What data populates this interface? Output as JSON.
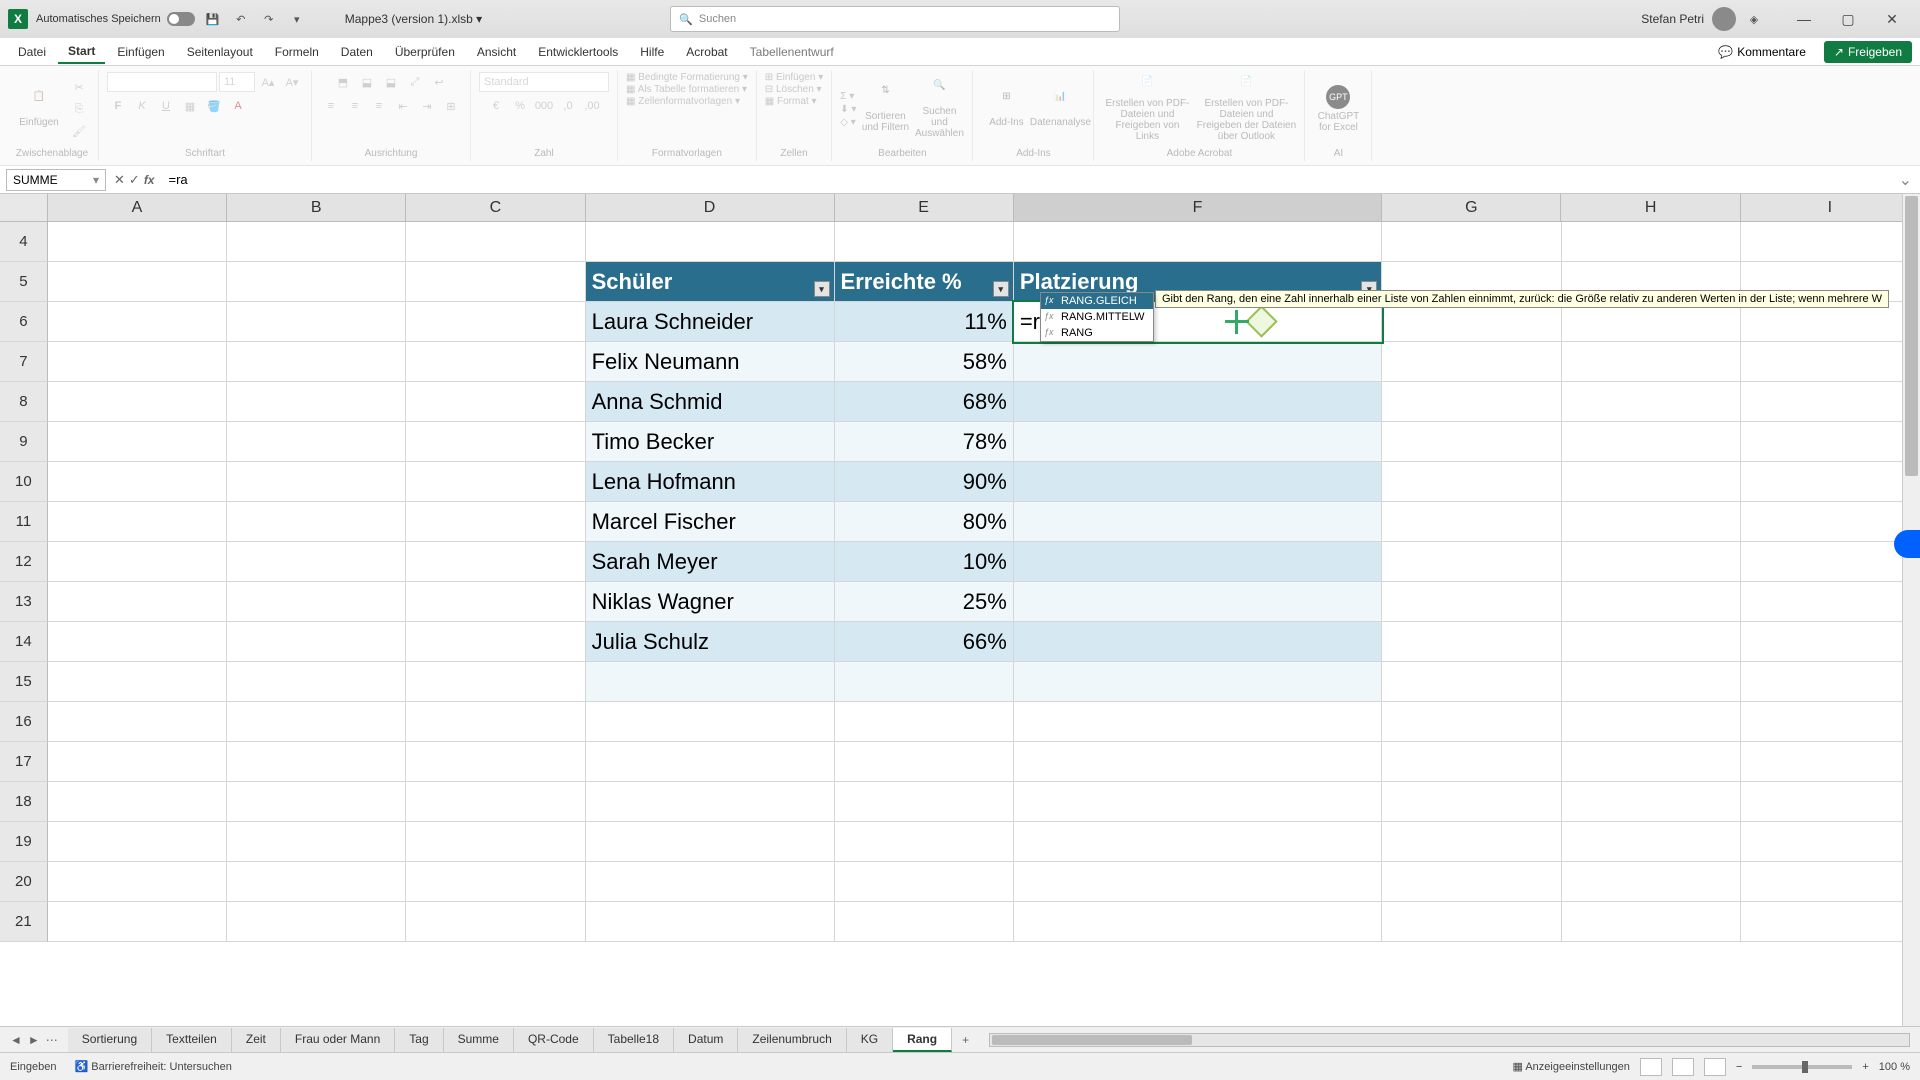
{
  "titlebar": {
    "autosave": "Automatisches Speichern",
    "filename": "Mappe3 (version 1).xlsb",
    "search_placeholder": "Suchen",
    "user": "Stefan Petri"
  },
  "tabs": {
    "datei": "Datei",
    "start": "Start",
    "einfuegen": "Einfügen",
    "seitenlayout": "Seitenlayout",
    "formeln": "Formeln",
    "daten": "Daten",
    "ueberpruefen": "Überprüfen",
    "ansicht": "Ansicht",
    "entwicklertools": "Entwicklertools",
    "hilfe": "Hilfe",
    "acrobat": "Acrobat",
    "tabellenentwurf": "Tabellenentwurf",
    "kommentare": "Kommentare",
    "freigeben": "Freigeben"
  },
  "ribbon": {
    "einfuegen": "Einfügen",
    "zwischenablage": "Zwischenablage",
    "schriftart": "Schriftart",
    "ausrichtung": "Ausrichtung",
    "zahl": "Zahl",
    "formatvorlagen": "Formatvorlagen",
    "zellen": "Zellen",
    "bearbeiten": "Bearbeiten",
    "addins": "Add-Ins",
    "adobe": "Adobe Acrobat",
    "ai": "AI",
    "standard": "Standard",
    "font_size": "11",
    "bedingte": "Bedingte Formatierung",
    "alstabelle": "Als Tabelle formatieren",
    "zellenformat": "Zellenformatvorlagen",
    "zellen_einfuegen": "Einfügen",
    "loeschen": "Löschen",
    "format": "Format",
    "sortieren": "Sortieren und Filtern",
    "suchen": "Suchen und Auswählen",
    "addins_btn": "Add-Ins",
    "datenanalyse": "Datenanalyse",
    "pdf1": "Erstellen von PDF-Dateien und Freigeben von Links",
    "pdf2": "Erstellen von PDF-Dateien und Freigeben der Dateien über Outlook",
    "chatgpt": "ChatGPT for Excel"
  },
  "formula": {
    "namebox": "SUMME",
    "content": "=ra"
  },
  "headers": {
    "A": "A",
    "B": "B",
    "C": "C",
    "D": "D",
    "E": "E",
    "F": "F",
    "G": "G",
    "H": "H",
    "I": "I"
  },
  "rows": [
    "4",
    "5",
    "6",
    "7",
    "8",
    "9",
    "10",
    "11",
    "12",
    "13",
    "14",
    "15",
    "16",
    "17",
    "18",
    "19",
    "20",
    "21"
  ],
  "table": {
    "col1": "Schüler",
    "col2": "Erreichte %",
    "col3": "Platzierung",
    "data": [
      {
        "name": "Laura Schneider",
        "pct": "11%"
      },
      {
        "name": "Felix Neumann",
        "pct": "58%"
      },
      {
        "name": "Anna Schmid",
        "pct": "68%"
      },
      {
        "name": "Timo Becker",
        "pct": "78%"
      },
      {
        "name": "Lena Hofmann",
        "pct": "90%"
      },
      {
        "name": "Marcel Fischer",
        "pct": "80%"
      },
      {
        "name": "Sarah Meyer",
        "pct": "10%"
      },
      {
        "name": "Niklas Wagner",
        "pct": "25%"
      },
      {
        "name": "Julia Schulz",
        "pct": "66%"
      }
    ]
  },
  "autocomplete": {
    "items": [
      "RANG.GLEICH",
      "RANG.MITTELW",
      "RANG"
    ],
    "tooltip": "Gibt den Rang, den eine Zahl innerhalb einer Liste von Zahlen einnimmt, zurück: die Größe relativ zu anderen Werten in der Liste; wenn mehrere W"
  },
  "cell_edit": "=ra",
  "sheets": [
    "Sortierung",
    "Textteilen",
    "Zeit",
    "Frau oder Mann",
    "Tag",
    "Summe",
    "QR-Code",
    "Tabelle18",
    "Datum",
    "Zeilenumbruch",
    "KG",
    "Rang"
  ],
  "status": {
    "mode": "Eingeben",
    "access": "Barrierefreiheit: Untersuchen",
    "display": "Anzeigeeinstellungen",
    "zoom": "100 %"
  }
}
